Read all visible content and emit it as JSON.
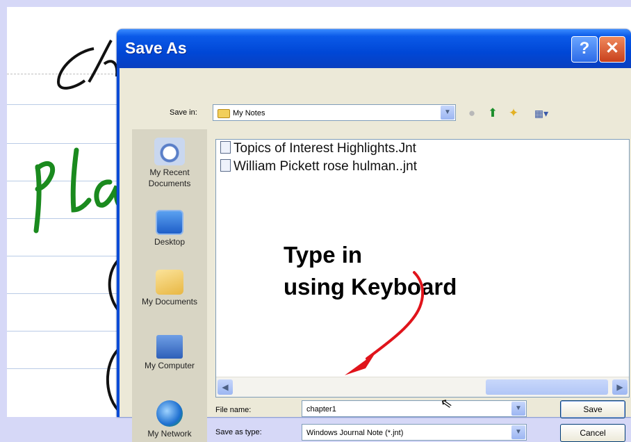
{
  "dialog": {
    "title": "Save As",
    "help_button": "?",
    "close_button": "✕"
  },
  "save_in": {
    "label": "Save in:",
    "value": "My Notes",
    "icon": "folder-icon"
  },
  "toolbar_icons": [
    "back-icon",
    "up-folder-icon",
    "new-folder-icon",
    "views-menu-icon"
  ],
  "places": [
    {
      "label": "My Recent Documents",
      "icon": "recent-documents-icon"
    },
    {
      "label": "Desktop",
      "icon": "desktop-icon"
    },
    {
      "label": "My Documents",
      "icon": "my-documents-icon"
    },
    {
      "label": "My Computer",
      "icon": "my-computer-icon"
    },
    {
      "label": "My Network",
      "icon": "my-network-icon"
    }
  ],
  "files": [
    {
      "name": "Topics of Interest Highlights.Jnt"
    },
    {
      "name": "William Pickett rose hulman..jnt"
    }
  ],
  "annotation": {
    "line1": "Type in",
    "line2": "using Keyboard",
    "arrow_color": "#e0141b"
  },
  "file_name": {
    "label": "File name:",
    "value": "chapter1"
  },
  "save_as_type": {
    "label": "Save as type:",
    "value": "Windows Journal Note (*.jnt)"
  },
  "buttons": {
    "save": "Save",
    "cancel": "Cancel"
  },
  "colors": {
    "title_bar": "#0047d6",
    "dialog_body": "#ece9d8",
    "ink_black": "#111111",
    "ink_green": "#1a8a1e",
    "background": "#d6d8f7"
  }
}
